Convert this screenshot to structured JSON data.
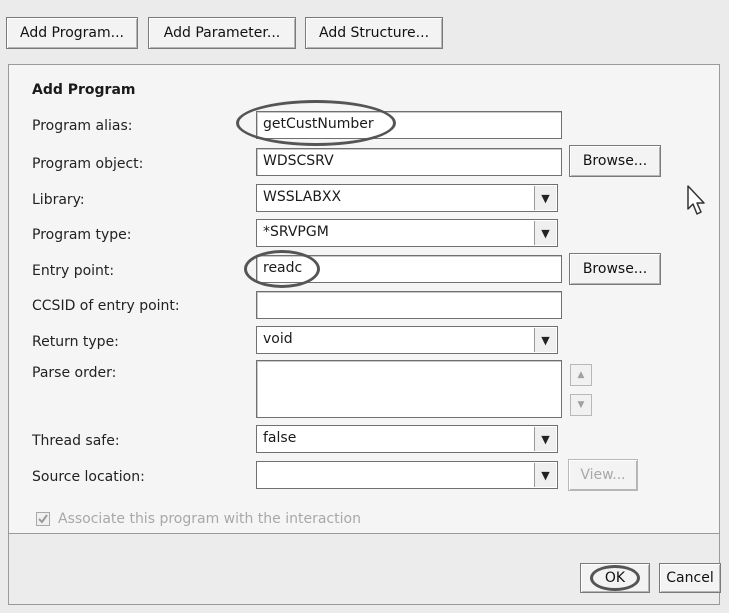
{
  "toolbar": {
    "add_program": "Add Program...",
    "add_parameter": "Add Parameter...",
    "add_structure": "Add Structure..."
  },
  "section_title": "Add Program",
  "fields": {
    "program_alias": {
      "label": "Program alias:",
      "value": "getCustNumber"
    },
    "program_object": {
      "label": "Program object:",
      "value": "WDSCSRV",
      "browse": "Browse..."
    },
    "library": {
      "label": "Library:",
      "value": "WSSLABXX"
    },
    "program_type": {
      "label": "Program type:",
      "value": "*SRVPGM"
    },
    "entry_point": {
      "label": "Entry point:",
      "value": "readc",
      "browse": "Browse..."
    },
    "ccsid": {
      "label": "CCSID of entry point:",
      "value": ""
    },
    "return_type": {
      "label": "Return type:",
      "value": "void"
    },
    "parse_order": {
      "label": "Parse order:"
    },
    "thread_safe": {
      "label": "Thread safe:",
      "value": "false"
    },
    "source_location": {
      "label": "Source location:",
      "value": "",
      "view": "View..."
    }
  },
  "associate_checkbox": {
    "label": "Associate this program with the interaction",
    "checked": true
  },
  "dialog": {
    "ok": "OK",
    "cancel": "Cancel"
  },
  "icons": {
    "dropdown": "chevron-down-icon",
    "checkmark": "check-icon",
    "cursor": "pointer-cursor-icon"
  }
}
